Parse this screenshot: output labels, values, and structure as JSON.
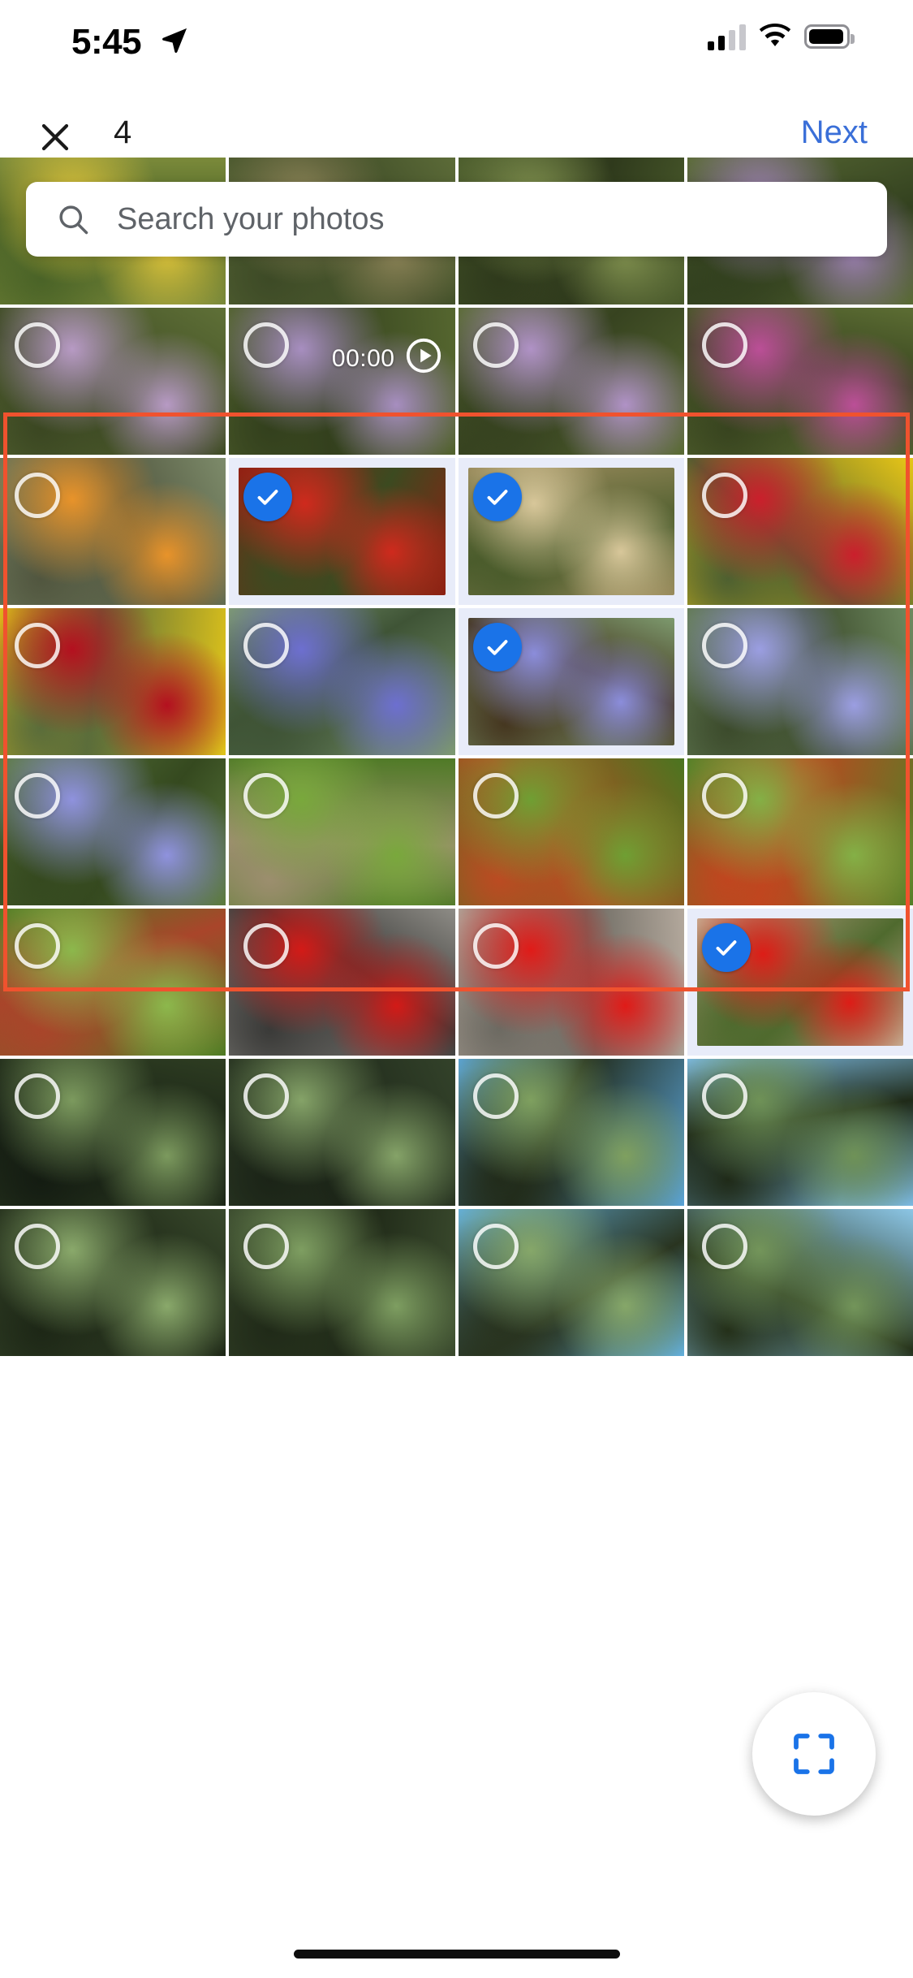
{
  "status_bar": {
    "time": "5:45",
    "location_icon": "location-arrow-icon",
    "cellular_icon": "signal-bars-icon",
    "wifi_icon": "wifi-icon",
    "battery_icon": "battery-icon"
  },
  "nav_bar": {
    "close_icon": "close-icon",
    "selected_count": "4",
    "next_label": "Next",
    "next_color": "#3a6fd8"
  },
  "search": {
    "icon": "search-icon",
    "placeholder": "Search your photos",
    "value": ""
  },
  "selection": {
    "highlight_color": "#f0522e",
    "check_color": "#1a73e8",
    "selected_tile_bg": "#e8ecf9",
    "count": 4
  },
  "fab": {
    "icon": "fullscreen-expand-icon",
    "icon_color": "#1a73e8",
    "background": "#ffffff"
  },
  "grid": {
    "columns": 4,
    "video_badge": {
      "duration": "00:00",
      "play_icon": "play-circle-icon"
    },
    "tiles": [
      {
        "id": "t1",
        "alt": "yellow flower closeup",
        "selected": false,
        "circle": false,
        "video": false,
        "c1": "#d9c13a",
        "c2": "#7b8a3a",
        "c3": "#4a6327"
      },
      {
        "id": "t2",
        "alt": "butterfly on dry leaves",
        "selected": false,
        "circle": false,
        "video": false,
        "c1": "#8a8256",
        "c2": "#5c6b38",
        "c3": "#3d4a26"
      },
      {
        "id": "t3",
        "alt": "lantana with butterfly",
        "selected": false,
        "circle": false,
        "video": false,
        "c1": "#7f8f4e",
        "c2": "#4b5c2c",
        "c3": "#2f3a1c"
      },
      {
        "id": "t4",
        "alt": "purple lantana blooms",
        "selected": false,
        "circle": false,
        "video": false,
        "c1": "#9a7fae",
        "c2": "#5a6b35",
        "c3": "#33411f"
      },
      {
        "id": "t5",
        "alt": "lantana patch ground",
        "selected": false,
        "circle": true,
        "video": false,
        "c1": "#b79ac4",
        "c2": "#5f7037",
        "c3": "#3b4722"
      },
      {
        "id": "t6",
        "alt": "video of lantana and butterfly",
        "selected": false,
        "circle": true,
        "video": true,
        "c1": "#a78ec0",
        "c2": "#55662f",
        "c3": "#33401d"
      },
      {
        "id": "t7",
        "alt": "orange butterfly on lantana",
        "selected": false,
        "circle": true,
        "video": false,
        "c1": "#b092c6",
        "c2": "#5a6b34",
        "c3": "#374320"
      },
      {
        "id": "t8",
        "alt": "magenta lantana flowers",
        "selected": false,
        "circle": true,
        "video": false,
        "c1": "#bb4f97",
        "c2": "#5c6d33",
        "c3": "#38441f"
      },
      {
        "id": "t9",
        "alt": "orange poppy on gravel",
        "selected": false,
        "circle": true,
        "video": false,
        "c1": "#e8932a",
        "c2": "#7d8b6a",
        "c3": "#51563f"
      },
      {
        "id": "t10",
        "alt": "red gaillardia cluster",
        "selected": true,
        "circle": false,
        "video": false,
        "c1": "#cf2a1d",
        "c2": "#8e2012",
        "c3": "#3c4a20"
      },
      {
        "id": "t11",
        "alt": "dried seed head pod",
        "selected": true,
        "circle": false,
        "video": false,
        "c1": "#d8c79a",
        "c2": "#9a8b5c",
        "c3": "#4b5c2c"
      },
      {
        "id": "t12",
        "alt": "red gaillardia yellow center",
        "selected": false,
        "circle": true,
        "video": false,
        "c1": "#cb1f2c",
        "c2": "#e8c617",
        "c3": "#4e6030"
      },
      {
        "id": "t13",
        "alt": "crimson gaillardia bloom",
        "selected": false,
        "circle": true,
        "video": false,
        "c1": "#b4101f",
        "c2": "#e0c41a",
        "c3": "#5b6d3a"
      },
      {
        "id": "t14",
        "alt": "blue iris bud with leaves",
        "selected": false,
        "circle": true,
        "video": false,
        "c1": "#6d6fd0",
        "c2": "#7e9a72",
        "c3": "#3f5436"
      },
      {
        "id": "t15",
        "alt": "purple iris flower",
        "selected": true,
        "circle": false,
        "video": false,
        "c1": "#8b8ddb",
        "c2": "#7d9a6e",
        "c3": "#45361f"
      },
      {
        "id": "t16",
        "alt": "light purple iris petals",
        "selected": false,
        "circle": true,
        "video": false,
        "c1": "#9b9ee2",
        "c2": "#6f8a60",
        "c3": "#3c4b2c"
      },
      {
        "id": "t17",
        "alt": "iris among green leaves",
        "selected": false,
        "circle": true,
        "video": false,
        "c1": "#8f92de",
        "c2": "#5d7c3f",
        "c3": "#35491f"
      },
      {
        "id": "t18",
        "alt": "ladybug on green leaf",
        "selected": false,
        "circle": true,
        "video": false,
        "c1": "#79a83c",
        "c2": "#4f7a26",
        "c3": "#9c8e6e"
      },
      {
        "id": "t19",
        "alt": "ladybug on leaf veins",
        "selected": false,
        "circle": true,
        "video": false,
        "c1": "#6f9f33",
        "c2": "#4a7520",
        "c3": "#bb4b22"
      },
      {
        "id": "t20",
        "alt": "ladybugs on broad leaf",
        "selected": false,
        "circle": true,
        "video": false,
        "c1": "#84b046",
        "c2": "#547f27",
        "c3": "#c0461f"
      },
      {
        "id": "t21",
        "alt": "leaf with ladybug close",
        "selected": false,
        "circle": true,
        "video": false,
        "c1": "#8cb84c",
        "c2": "#4f7c24",
        "c3": "#a9452a"
      },
      {
        "id": "t22",
        "alt": "red hibiscus on pavement",
        "selected": false,
        "circle": true,
        "video": false,
        "c1": "#d31a17",
        "c2": "#8e8c86",
        "c3": "#3a3a38"
      },
      {
        "id": "t23",
        "alt": "red hibiscus bloom",
        "selected": false,
        "circle": true,
        "video": false,
        "c1": "#e01b18",
        "c2": "#b3a89c",
        "c3": "#6d6a62"
      },
      {
        "id": "t24",
        "alt": "red hibiscus in hand",
        "selected": true,
        "circle": false,
        "video": false,
        "c1": "#dd1d17",
        "c2": "#c8a98e",
        "c3": "#4f6a2e"
      },
      {
        "id": "t25",
        "alt": "tree canopy with beam",
        "selected": false,
        "circle": true,
        "video": false,
        "c1": "#7c9a5e",
        "c2": "#2e3d22",
        "c3": "#141c12"
      },
      {
        "id": "t26",
        "alt": "tree canopy dark branches",
        "selected": false,
        "circle": true,
        "video": false,
        "c1": "#85a368",
        "c2": "#33422a",
        "c3": "#1b2417"
      },
      {
        "id": "t27",
        "alt": "canopy with blue sky",
        "selected": false,
        "circle": true,
        "video": false,
        "c1": "#7fa05f",
        "c2": "#5aa3d6",
        "c3": "#222c1b"
      },
      {
        "id": "t28",
        "alt": "canopy with roofline",
        "selected": false,
        "circle": true,
        "video": false,
        "c1": "#6f9257",
        "c2": "#7cb9e0",
        "c3": "#1f2a18"
      },
      {
        "id": "t29",
        "alt": "branches against sky",
        "selected": false,
        "circle": true,
        "video": false,
        "c1": "#8aa96b",
        "c2": "#39492c",
        "c3": "#1d2716"
      },
      {
        "id": "t30",
        "alt": "leafy branches sky",
        "selected": false,
        "circle": true,
        "video": false,
        "c1": "#7e9e61",
        "c2": "#3b4b2e",
        "c3": "#202a18"
      },
      {
        "id": "t31",
        "alt": "tree top blue sky",
        "selected": false,
        "circle": true,
        "video": false,
        "c1": "#86a769",
        "c2": "#64b0db",
        "c3": "#293420"
      },
      {
        "id": "t32",
        "alt": "sky through foliage",
        "selected": false,
        "circle": true,
        "video": false,
        "c1": "#73955a",
        "c2": "#8cc6e6",
        "c3": "#243019"
      }
    ]
  },
  "home_indicator": "home-indicator"
}
